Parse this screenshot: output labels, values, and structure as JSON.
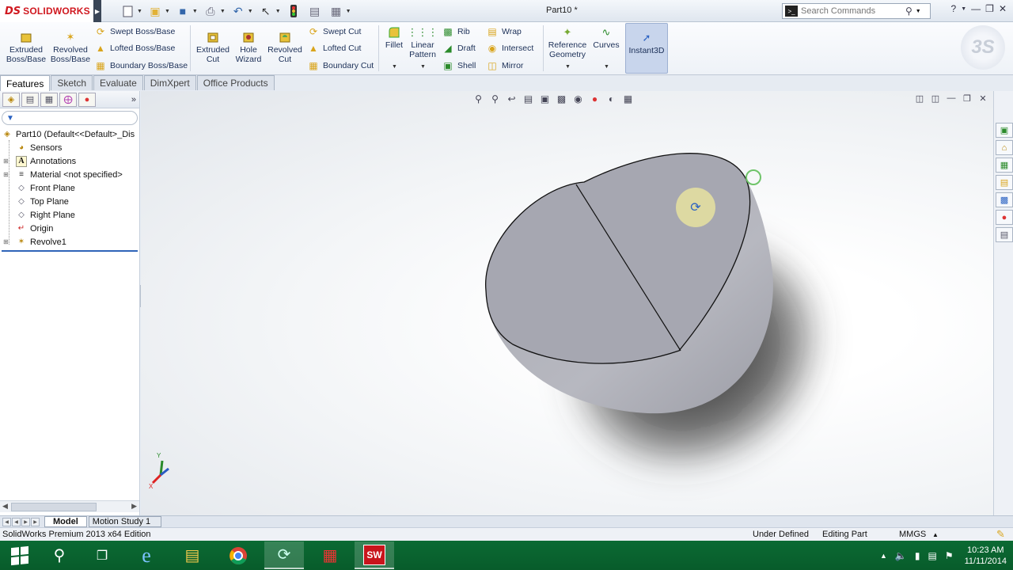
{
  "app": {
    "logo_mark": "DS",
    "logo_text": "SOLIDWORKS",
    "doc_title": "Part10 *",
    "search_placeholder": "Search Commands",
    "help_icon": "?",
    "watermark": "3S"
  },
  "ribbon": {
    "extruded_boss": "Extruded Boss/Base",
    "revolved_boss": "Revolved Boss/Base",
    "swept_boss": "Swept Boss/Base",
    "lofted_boss": "Lofted Boss/Base",
    "boundary_boss": "Boundary Boss/Base",
    "extruded_cut": "Extruded Cut",
    "hole_wizard": "Hole Wizard",
    "revolved_cut": "Revolved Cut",
    "swept_cut": "Swept Cut",
    "lofted_cut": "Lofted Cut",
    "boundary_cut": "Boundary Cut",
    "fillet": "Fillet",
    "linear_pattern": "Linear Pattern",
    "rib": "Rib",
    "draft": "Draft",
    "shell": "Shell",
    "wrap": "Wrap",
    "intersect": "Intersect",
    "mirror": "Mirror",
    "reference_geometry": "Reference Geometry",
    "curves": "Curves",
    "instant3d": "Instant3D"
  },
  "tabs": [
    "Features",
    "Sketch",
    "Evaluate",
    "DimXpert",
    "Office Products"
  ],
  "tree": {
    "root": "Part10  (Default<<Default>_Dis",
    "items": [
      {
        "label": "Sensors",
        "expandable": false
      },
      {
        "label": "Annotations",
        "expandable": true
      },
      {
        "label": "Material <not specified>",
        "expandable": true
      },
      {
        "label": "Front Plane",
        "expandable": false
      },
      {
        "label": "Top Plane",
        "expandable": false
      },
      {
        "label": "Right Plane",
        "expandable": false
      },
      {
        "label": "Origin",
        "expandable": false
      },
      {
        "label": "Revolve1",
        "expandable": true
      }
    ]
  },
  "bottom_tabs": {
    "model": "Model",
    "motion_study": "Motion Study 1"
  },
  "status": {
    "edition": "SolidWorks Premium 2013 x64 Edition",
    "definition": "Under Defined",
    "mode": "Editing Part",
    "units": "MMGS"
  },
  "taskbar": {
    "time": "10:23 AM",
    "date": "11/11/2014",
    "sw_label": "SW"
  },
  "triad": {
    "y_label": "Y",
    "x_label": "X"
  },
  "colors": {
    "solidworks_red": "#d0181f",
    "taskbar_green": "#0b6a33",
    "model_face": "#a6a7b1",
    "selection_blue": "#2f64b8"
  }
}
